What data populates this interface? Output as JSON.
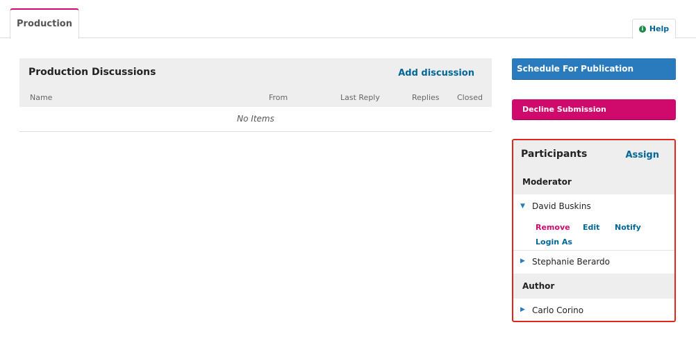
{
  "tabs": [
    {
      "label": "Production"
    }
  ],
  "help": {
    "label": "Help",
    "icon": "info-icon"
  },
  "discussions": {
    "title": "Production Discussions",
    "add_label": "Add discussion",
    "columns": [
      "Name",
      "From",
      "Last Reply",
      "Replies",
      "Closed"
    ],
    "empty_text": "No Items"
  },
  "actions": {
    "schedule_label": "Schedule For Publication",
    "decline_label": "Decline Submission"
  },
  "participants": {
    "title": "Participants",
    "assign_label": "Assign",
    "groups": [
      {
        "role": "Moderator",
        "people": [
          {
            "name": "David Buskins",
            "expanded": true,
            "actions": [
              "Remove",
              "Edit",
              "Notify",
              "Login As"
            ]
          },
          {
            "name": "Stephanie Berardo",
            "expanded": false
          }
        ]
      },
      {
        "role": "Author",
        "people": [
          {
            "name": "Carlo Corino",
            "expanded": false
          }
        ]
      }
    ]
  },
  "colors": {
    "accent_blue": "#2a7bbd",
    "link_blue": "#006798",
    "danger_pink": "#d00a6c",
    "highlight_red": "#e0251b"
  }
}
